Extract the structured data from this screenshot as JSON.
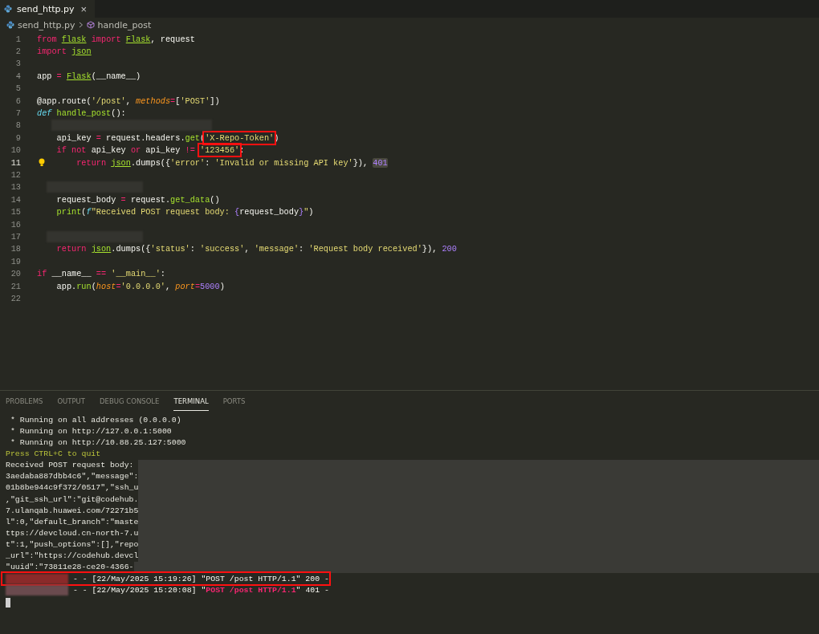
{
  "tabs": [
    {
      "label": "send_http.py",
      "close": "×",
      "selected": true
    }
  ],
  "breadcrumb": [
    "send_http.py",
    "handle_post"
  ],
  "code": [
    {
      "number": "1",
      "kind": "code",
      "current": false,
      "hint": false,
      "tokens": [
        {
          "kind": "kw",
          "text": "from "
        },
        {
          "kind": "mod",
          "text": "flask"
        },
        {
          "kind": "kw",
          "text": " import "
        },
        {
          "kind": "mod",
          "text": "Flask"
        },
        {
          "kind": "plain",
          "text": ", request"
        }
      ]
    },
    {
      "number": "2",
      "kind": "code",
      "current": false,
      "hint": false,
      "tokens": [
        {
          "kind": "kw",
          "text": "import "
        },
        {
          "kind": "mod",
          "text": "json"
        }
      ]
    },
    {
      "number": "3",
      "kind": "blank",
      "current": false,
      "hint": false
    },
    {
      "number": "4",
      "kind": "code",
      "current": false,
      "hint": false,
      "tokens": [
        {
          "kind": "plain",
          "text": "app "
        },
        {
          "kind": "kw",
          "text": "= "
        },
        {
          "kind": "mod",
          "text": "Flask"
        },
        {
          "kind": "plain",
          "text": "(__name__)"
        }
      ]
    },
    {
      "number": "5",
      "kind": "blank",
      "current": false,
      "hint": false
    },
    {
      "number": "6",
      "kind": "code",
      "current": false,
      "hint": false,
      "tokens": [
        {
          "kind": "plain",
          "text": "@app.route("
        },
        {
          "kind": "str",
          "text": "'/post'"
        },
        {
          "kind": "plain",
          "text": ", "
        },
        {
          "kind": "param",
          "text": "methods"
        },
        {
          "kind": "kw",
          "text": "="
        },
        {
          "kind": "plain",
          "text": "["
        },
        {
          "kind": "str",
          "text": "'POST'"
        },
        {
          "kind": "plain",
          "text": "])"
        }
      ]
    },
    {
      "number": "7",
      "kind": "code",
      "current": false,
      "hint": false,
      "tokens": [
        {
          "kind": "def",
          "text": "def "
        },
        {
          "kind": "fn",
          "text": "handle_post"
        },
        {
          "kind": "plain",
          "text": "():"
        }
      ]
    },
    {
      "number": "8",
      "kind": "redacted",
      "current": false,
      "hint": false
    },
    {
      "number": "9",
      "kind": "code",
      "current": false,
      "hint": false,
      "tokens": [
        {
          "kind": "plain",
          "text": "    api_key "
        },
        {
          "kind": "kw",
          "text": "="
        },
        {
          "kind": "plain",
          "text": " request.headers."
        },
        {
          "kind": "fn",
          "text": "get"
        },
        {
          "kind": "plain",
          "text": "("
        },
        {
          "kind": "str",
          "text": "'X-Repo-Token'",
          "highlighted": true
        },
        {
          "kind": "plain",
          "text": ")"
        }
      ]
    },
    {
      "number": "10",
      "kind": "code",
      "current": false,
      "hint": false,
      "tokens": [
        {
          "kind": "kw",
          "text": "    if not"
        },
        {
          "kind": "plain",
          "text": " api_key "
        },
        {
          "kind": "kw",
          "text": "or"
        },
        {
          "kind": "plain",
          "text": " api_key "
        },
        {
          "kind": "kw",
          "text": "!= "
        },
        {
          "kind": "str",
          "text": "'123456'",
          "highlighted": true
        },
        {
          "kind": "plain",
          "text": ":"
        }
      ]
    },
    {
      "number": "11",
      "kind": "code",
      "current": true,
      "hint": true,
      "tokens": [
        {
          "kind": "kw",
          "text": "        return "
        },
        {
          "kind": "mod",
          "text": "json"
        },
        {
          "kind": "plain",
          "text": ".dumps({"
        },
        {
          "kind": "str",
          "text": "'error'"
        },
        {
          "kind": "plain",
          "text": ": "
        },
        {
          "kind": "str",
          "text": "'Invalid or missing API key'"
        },
        {
          "kind": "plain",
          "text": "}), "
        },
        {
          "kind": "numbox",
          "text": "401"
        }
      ]
    },
    {
      "number": "12",
      "kind": "blank",
      "current": false,
      "hint": false
    },
    {
      "number": "13",
      "kind": "redacted",
      "current": false,
      "hint": false
    },
    {
      "number": "14",
      "kind": "code",
      "current": false,
      "hint": false,
      "tokens": [
        {
          "kind": "plain",
          "text": "    request_body "
        },
        {
          "kind": "kw",
          "text": "="
        },
        {
          "kind": "plain",
          "text": " request."
        },
        {
          "kind": "fn",
          "text": "get_data"
        },
        {
          "kind": "plain",
          "text": "()"
        }
      ]
    },
    {
      "number": "15",
      "kind": "code",
      "current": false,
      "hint": false,
      "tokens": [
        {
          "kind": "fn",
          "text": "    print"
        },
        {
          "kind": "plain",
          "text": "("
        },
        {
          "kind": "def",
          "text": "f"
        },
        {
          "kind": "str",
          "text": "\"Received POST request body: "
        },
        {
          "kind": "num",
          "text": "{"
        },
        {
          "kind": "plain",
          "text": "request_body"
        },
        {
          "kind": "num",
          "text": "}"
        },
        {
          "kind": "str",
          "text": "\""
        },
        {
          "kind": "plain",
          "text": ")"
        }
      ]
    },
    {
      "number": "16",
      "kind": "blank",
      "current": false,
      "hint": false
    },
    {
      "number": "17",
      "kind": "redacted",
      "current": false,
      "hint": false
    },
    {
      "number": "18",
      "kind": "code",
      "current": false,
      "hint": false,
      "tokens": [
        {
          "kind": "kw",
          "text": "    return "
        },
        {
          "kind": "mod",
          "text": "json"
        },
        {
          "kind": "plain",
          "text": ".dumps({"
        },
        {
          "kind": "str",
          "text": "'status'"
        },
        {
          "kind": "plain",
          "text": ": "
        },
        {
          "kind": "str",
          "text": "'success'"
        },
        {
          "kind": "plain",
          "text": ", "
        },
        {
          "kind": "str",
          "text": "'message'"
        },
        {
          "kind": "plain",
          "text": ": "
        },
        {
          "kind": "str",
          "text": "'Request body received'"
        },
        {
          "kind": "plain",
          "text": "}), "
        },
        {
          "kind": "num",
          "text": "200"
        }
      ]
    },
    {
      "number": "19",
      "kind": "blank",
      "current": false,
      "hint": false
    },
    {
      "number": "20",
      "kind": "code",
      "current": false,
      "hint": false,
      "tokens": [
        {
          "kind": "kw",
          "text": "if"
        },
        {
          "kind": "plain",
          "text": " __name__ "
        },
        {
          "kind": "kw",
          "text": "== "
        },
        {
          "kind": "str",
          "text": "'__main__'"
        },
        {
          "kind": "plain",
          "text": ":"
        }
      ]
    },
    {
      "number": "21",
      "kind": "code",
      "current": false,
      "hint": false,
      "tokens": [
        {
          "kind": "plain",
          "text": "    app."
        },
        {
          "kind": "fn",
          "text": "run"
        },
        {
          "kind": "plain",
          "text": "("
        },
        {
          "kind": "param",
          "text": "host"
        },
        {
          "kind": "kw",
          "text": "="
        },
        {
          "kind": "str",
          "text": "'0.0.0.0'"
        },
        {
          "kind": "plain",
          "text": ", "
        },
        {
          "kind": "param",
          "text": "port"
        },
        {
          "kind": "kw",
          "text": "="
        },
        {
          "kind": "num",
          "text": "5000"
        },
        {
          "kind": "plain",
          "text": ")"
        }
      ]
    },
    {
      "number": "22",
      "kind": "blank",
      "current": false,
      "hint": false
    }
  ],
  "panel_tabs": [
    {
      "label": "PROBLEMS",
      "selected": false
    },
    {
      "label": "OUTPUT",
      "selected": false
    },
    {
      "label": "DEBUG CONSOLE",
      "selected": false
    },
    {
      "label": "TERMINAL",
      "selected": true
    },
    {
      "label": "PORTS",
      "selected": false
    }
  ],
  "terminal": [
    {
      "kind": "text",
      "text": " * Running on all addresses (0.0.0.0)"
    },
    {
      "kind": "text",
      "text": " * Running on http://127.0.0.1:5000"
    },
    {
      "kind": "text",
      "text": " * Running on http://10.88.25.127:5000"
    },
    {
      "kind": "notice",
      "text": "Press CTRL+C to quit"
    },
    {
      "kind": "body",
      "text": "Received POST request body: "
    },
    {
      "kind": "body",
      "text": "3aedaba887dbb4c6\",\"message\":"
    },
    {
      "kind": "body",
      "text": "01b8be944c9f372/0517\",\"ssh_u"
    },
    {
      "kind": "body",
      "text": ",\"git_ssh_url\":\"git@codehub."
    },
    {
      "kind": "body",
      "text": "7.ulanqab.huawei.com/72271b5"
    },
    {
      "kind": "body",
      "text": "l\":0,\"default_branch\":\"maste"
    },
    {
      "kind": "body",
      "text": "ttps://devcloud.cn-north-7.u"
    },
    {
      "kind": "body",
      "text": "t\":1,\"push_options\":[],\"repo"
    },
    {
      "kind": "body",
      "text": "_url\":\"https://codehub.devcl"
    },
    {
      "kind": "body",
      "text": "\"uuid\":\"73811e28-ce20-4366-"
    },
    {
      "kind": "log",
      "highlighted": true,
      "segments": [
        {
          "kind": "plain",
          "text": " - - [22/May/2025 15:19:26] \"POST /post HTTP/1.1\" 200 -"
        }
      ]
    },
    {
      "kind": "log",
      "highlighted": false,
      "segments": [
        {
          "kind": "plain",
          "text": " - - [22/May/2025 15:20:08] \""
        },
        {
          "kind": "error",
          "text": "POST /post HTTP/1.1"
        },
        {
          "kind": "plain",
          "text": "\" 401 -"
        }
      ]
    }
  ]
}
